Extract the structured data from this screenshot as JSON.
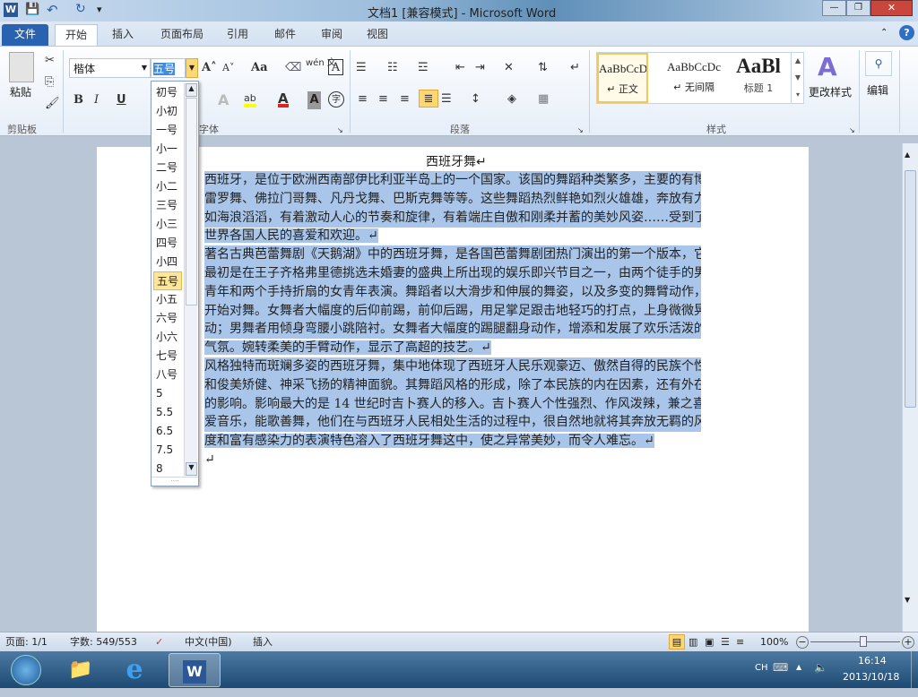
{
  "window": {
    "title": "文档1 [兼容模式] - Microsoft Word",
    "min": "—",
    "max": "❐",
    "close": "✕"
  },
  "qat": {
    "word": "W",
    "save": "💾",
    "undo": "↶",
    "redo": "↻",
    "more": "▾"
  },
  "tabs": [
    {
      "label": "文件"
    },
    {
      "label": "开始"
    },
    {
      "label": "插入"
    },
    {
      "label": "页面布局"
    },
    {
      "label": "引用"
    },
    {
      "label": "邮件"
    },
    {
      "label": "审阅"
    },
    {
      "label": "视图"
    }
  ],
  "ribbon": {
    "clipboard": {
      "paste": "粘贴",
      "label": "剪贴板"
    },
    "font": {
      "name": "楷体",
      "size": "五号",
      "label": "字体",
      "bold": "B",
      "italic": "I",
      "underline": "U",
      "grow": "A˄",
      "shrink": "A˅",
      "case": "Aa",
      "clear": "A",
      "phonetic": "wén 文",
      "border": "A",
      "highlight": "ab",
      "color": "A",
      "shade": "A",
      "circle": "字"
    },
    "paragraph": {
      "label": "段落"
    },
    "styles": {
      "label": "样式",
      "items": [
        {
          "preview": "AaBbCcDc",
          "name": "↵ 正文"
        },
        {
          "preview": "AaBbCcDc",
          "name": "↵ 无间隔"
        },
        {
          "preview": "AaBl",
          "name": "标题 1"
        }
      ],
      "change": "更改样式"
    },
    "editing": {
      "label": "编辑"
    }
  },
  "font_size_dropdown": {
    "selected": "五号",
    "options": [
      "初号",
      "小初",
      "一号",
      "小一",
      "二号",
      "小二",
      "三号",
      "小三",
      "四号",
      "小四",
      "五号",
      "小五",
      "六号",
      "小六",
      "七号",
      "八号",
      "5",
      "5.5",
      "6.5",
      "7.5",
      "8"
    ]
  },
  "document": {
    "title": "西班牙舞↵",
    "paragraphs": [
      [
        "西班牙，是位于欧洲西南部伊比利亚半岛上的一个国家。该国的舞蹈种类繁多，主要的有博",
        "雷罗舞、佛拉门哥舞、凡丹戈舞、巴斯克舞等等。这些舞蹈热烈鲜艳如烈火雄雄，奔放有力",
        "如海浪滔滔，有着激动人心的节奏和旋律，有着端庄自傲和刚柔并蓄的美妙风姿……受到了",
        "世界各国人民的喜爱和欢迎。↵"
      ],
      [
        "著名古典芭蕾舞剧《天鹅湖》中的西班牙舞，是各国芭蕾舞剧团热门演出的第一个版本，它",
        "最初是在王子齐格弗里德挑选未婚妻的盛典上所出现的娱乐即兴节目之一，由两个徒手的男",
        "青年和两个手持折扇的女青年表演。舞蹈者以大滑步和伸展的舞姿，以及多变的舞臂动作，",
        "开始对舞。女舞者大幅度的后仰前踢，前仰后踢，用足掌足跟击地轻巧的打点，上身微微晃",
        "动；男舞者用倾身弯腰小跳陪衬。女舞者大幅度的踢腿翻身动作，增添和发展了欢乐活泼的",
        "气氛。婉转柔美的手臂动作，显示了高超的技艺。↵"
      ],
      [
        "风格独特而斑斓多姿的西班牙舞，集中地体现了西班牙人民乐观豪迈、傲然自得的民族个性",
        "和俊美矫健、神采飞扬的精神面貌。其舞蹈风格的形成，除了本民族的内在因素，还有外在",
        "的影响。影响最大的是 14 世纪时吉卜赛人的移入。吉卜赛人个性强烈、作风泼辣，兼之喜",
        "爱音乐，能歌善舞，他们在与西班牙人民相处生活的过程中，很自然地就将其奔放无羁的风",
        "度和富有感染力的表演特色溶入了西班牙舞这中，使之异常美妙，而令人难忘。↵"
      ]
    ],
    "empty": "↵"
  },
  "statusbar": {
    "page": "页面: 1/1",
    "words": "字数: 549/553",
    "lang": "中文(中国)",
    "mode": "插入",
    "zoom": "100%",
    "zoom_level": 100
  },
  "taskbar": {
    "ime": "CH",
    "time": "16:14",
    "date": "2013/10/18"
  }
}
